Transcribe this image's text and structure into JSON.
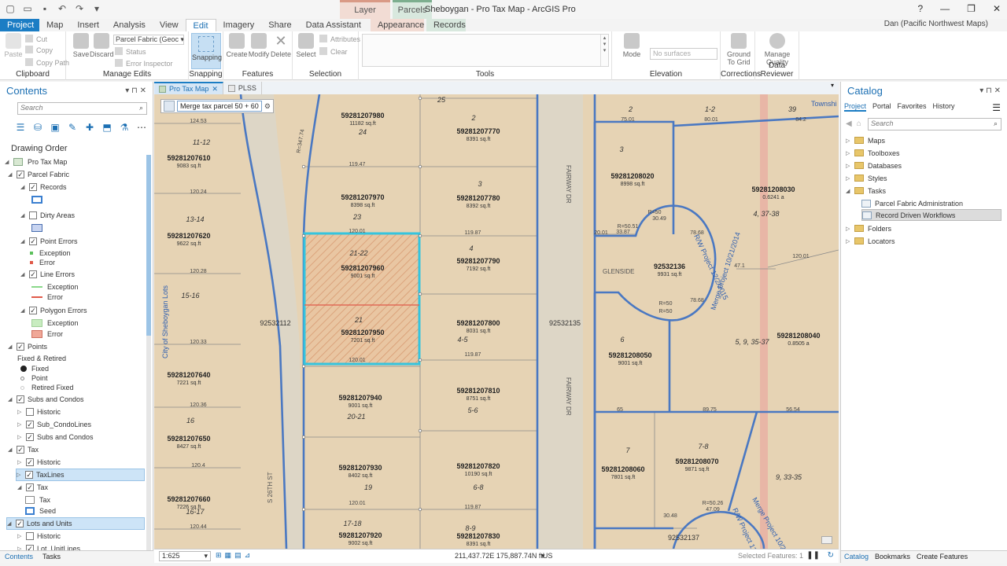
{
  "window": {
    "title": "Sheboygan - Pro Tax Map - ArcGIS Pro",
    "user": "Dan (Pacific Northwest Maps)",
    "context_tabs": [
      "Layer",
      "Parcels"
    ]
  },
  "ribbon_tabs": [
    "Project",
    "Map",
    "Insert",
    "Analysis",
    "View",
    "Edit",
    "Imagery",
    "Share",
    "Data Assistant",
    "Appearance",
    "Records"
  ],
  "ribbon": {
    "clipboard": {
      "label": "Clipboard",
      "paste": "Paste",
      "cut": "Cut",
      "copy": "Copy",
      "copy_path": "Copy Path"
    },
    "manage_edits": {
      "label": "Manage Edits",
      "save": "Save",
      "discard": "Discard",
      "workspace": "Parcel Fabric (Geoc",
      "status": "Status",
      "error_inspector": "Error Inspector"
    },
    "snapping": {
      "label": "Snapping",
      "button": "Snapping"
    },
    "features": {
      "label": "Features",
      "create": "Create",
      "modify": "Modify",
      "delete": "Delete"
    },
    "selection": {
      "label": "Selection",
      "select": "Select",
      "attributes": "Attributes",
      "clear": "Clear"
    },
    "tools": {
      "label": "Tools"
    },
    "elevation": {
      "label": "Elevation",
      "mode": "Mode",
      "surface": "No surfaces"
    },
    "corrections": {
      "label": "Corrections",
      "ground_to_grid": "Ground To Grid"
    },
    "data_reviewer": {
      "label": "Data Reviewer",
      "manage_quality": "Manage Quality"
    }
  },
  "contents": {
    "title": "Contents",
    "search_placeholder": "Search",
    "drawing_order": "Drawing Order",
    "items": [
      {
        "label": "Pro Tax Map"
      },
      {
        "label": "Parcel Fabric"
      },
      {
        "label": "Records"
      },
      {
        "label": "Dirty Areas"
      },
      {
        "label": "Point Errors"
      },
      {
        "label": "Exception"
      },
      {
        "label": "Error"
      },
      {
        "label": "Line Errors"
      },
      {
        "label": "Exception"
      },
      {
        "label": "Error"
      },
      {
        "label": "Polygon Errors"
      },
      {
        "label": "Exception"
      },
      {
        "label": "Error"
      },
      {
        "label": "Points"
      },
      {
        "label": "Fixed & Retired"
      },
      {
        "label": "Fixed"
      },
      {
        "label": "Point"
      },
      {
        "label": "Retired Fixed"
      },
      {
        "label": "Subs and Condos"
      },
      {
        "label": "Historic"
      },
      {
        "label": "Sub_CondoLines"
      },
      {
        "label": "Subs and Condos"
      },
      {
        "label": "Tax"
      },
      {
        "label": "Historic"
      },
      {
        "label": "TaxLines"
      },
      {
        "label": "Tax"
      },
      {
        "label": "Tax"
      },
      {
        "label": "Seed"
      },
      {
        "label": "Lots and Units"
      },
      {
        "label": "Historic"
      },
      {
        "label": "Lot_UnitLines"
      }
    ],
    "bottom_tabs": [
      "Contents",
      "Tasks"
    ]
  },
  "map": {
    "tabs": [
      "Pro Tax Map",
      "PLSS"
    ],
    "merge_task": "Merge tax parcel 50 + 60",
    "scale": "1:625",
    "coordinates": "211,437.72E 175,887.74N ftUS",
    "selected_features": "Selected Features: 1",
    "parcels": [
      {
        "id": "59281207980",
        "area": "11182 sq.ft",
        "lot": "24"
      },
      {
        "id": "59281207770",
        "area": "8391 sq.ft",
        "lot": "2"
      },
      {
        "id": "59281207610",
        "area": "9083 sq.ft",
        "lot": "11-12"
      },
      {
        "id": "59281207970",
        "area": "8398 sq.ft",
        "lot": "23"
      },
      {
        "id": "59281207780",
        "area": "8392 sq.ft",
        "lot": "3"
      },
      {
        "id": "59281207620",
        "area": "9622 sq.ft",
        "lot": "13-14"
      },
      {
        "id": "59281207960",
        "area": "9001 sq.ft",
        "lot": "21-22"
      },
      {
        "id": "59281207790",
        "area": "7192 sq.ft",
        "lot": "4"
      },
      {
        "id": "59281207950",
        "area": "7201 sq.ft",
        "lot": "21"
      },
      {
        "id": "59281207800",
        "area": "8031 sq.ft",
        "lot": "4-5"
      },
      {
        "id": "59281207640",
        "area": "7221 sq.ft",
        "lot": "15-16"
      },
      {
        "id": "59281207940",
        "area": "9001 sq.ft",
        "lot": "20-21"
      },
      {
        "id": "59281207810",
        "area": "8751 sq.ft",
        "lot": "5-6"
      },
      {
        "id": "59281207650",
        "area": "8427 sq.ft",
        "lot": "16"
      },
      {
        "id": "59281207930",
        "area": "8402 sq.ft",
        "lot": "19"
      },
      {
        "id": "59281207820",
        "area": "10190 sq.ft",
        "lot": "6-8"
      },
      {
        "id": "59281207660",
        "area": "7226 sq.ft",
        "lot": "16-17"
      },
      {
        "id": "59281207920",
        "area": "9002 sq.ft",
        "lot": "17-18"
      },
      {
        "id": "59281207830",
        "area": "8391 sq.ft",
        "lot": "8-9"
      },
      {
        "id": "59281208020",
        "area": "8998 sq.ft",
        "lot": "3"
      },
      {
        "id": "59281208030",
        "area": "0.6241 a",
        "lot": "4, 37-38"
      },
      {
        "id": "92532136",
        "area": "9931 sq.ft",
        "lot": ""
      },
      {
        "id": "59281208050",
        "area": "9001 sq.ft",
        "lot": "6"
      },
      {
        "id": "59281208040",
        "area": "0.8505 a",
        "lot": "5, 9, 35-37"
      },
      {
        "id": "59281208060",
        "area": "7801 sq.ft",
        "lot": "7"
      },
      {
        "id": "59281208070",
        "area": "9871 sq.ft",
        "lot": "7-8"
      }
    ],
    "blocks": [
      "92532112",
      "92532135",
      "92532137"
    ],
    "street_labels": [
      "S 26TH ST",
      "FAIRWAY DR",
      "FAIRWAY DR",
      "GLENSIDE"
    ],
    "misc_labels": [
      "City of Sheboygan Lots",
      "R/W Project 12/2/2015",
      "Merge Project 10/21/2014",
      "Merge Project 10/21/2014",
      "R/W Project 12/2/2015",
      "9, 33-35",
      "Townshi",
      "1-2",
      "39",
      "2",
      "25"
    ],
    "dimensions": [
      "124.53",
      "120.24",
      "120.28",
      "120.33",
      "120.36",
      "120.4",
      "120.44",
      "119.47",
      "120.01",
      "119.87",
      "120.01",
      "119.87",
      "120.01",
      "119.87",
      "75.01",
      "80.01",
      "84.2",
      "89.75",
      "56.54",
      "65",
      "47.1",
      "120.01",
      "33.87",
      "30.49",
      "20.01",
      "R=50.51",
      "R=50",
      "R=50",
      "78.68",
      "R=50",
      "78.68",
      "R=347.74",
      "R=50.26",
      "47.09",
      "30.48"
    ]
  },
  "catalog": {
    "title": "Catalog",
    "tabs": [
      "Project",
      "Portal",
      "Favorites",
      "History"
    ],
    "search_placeholder": "Search",
    "items": [
      {
        "label": "Maps"
      },
      {
        "label": "Toolboxes"
      },
      {
        "label": "Databases"
      },
      {
        "label": "Styles"
      },
      {
        "label": "Tasks"
      },
      {
        "label": "Parcel Fabric Administration"
      },
      {
        "label": "Record Driven Workflows"
      },
      {
        "label": "Folders"
      },
      {
        "label": "Locators"
      }
    ],
    "bottom_tabs": [
      "Catalog",
      "Bookmarks",
      "Create Features"
    ]
  }
}
